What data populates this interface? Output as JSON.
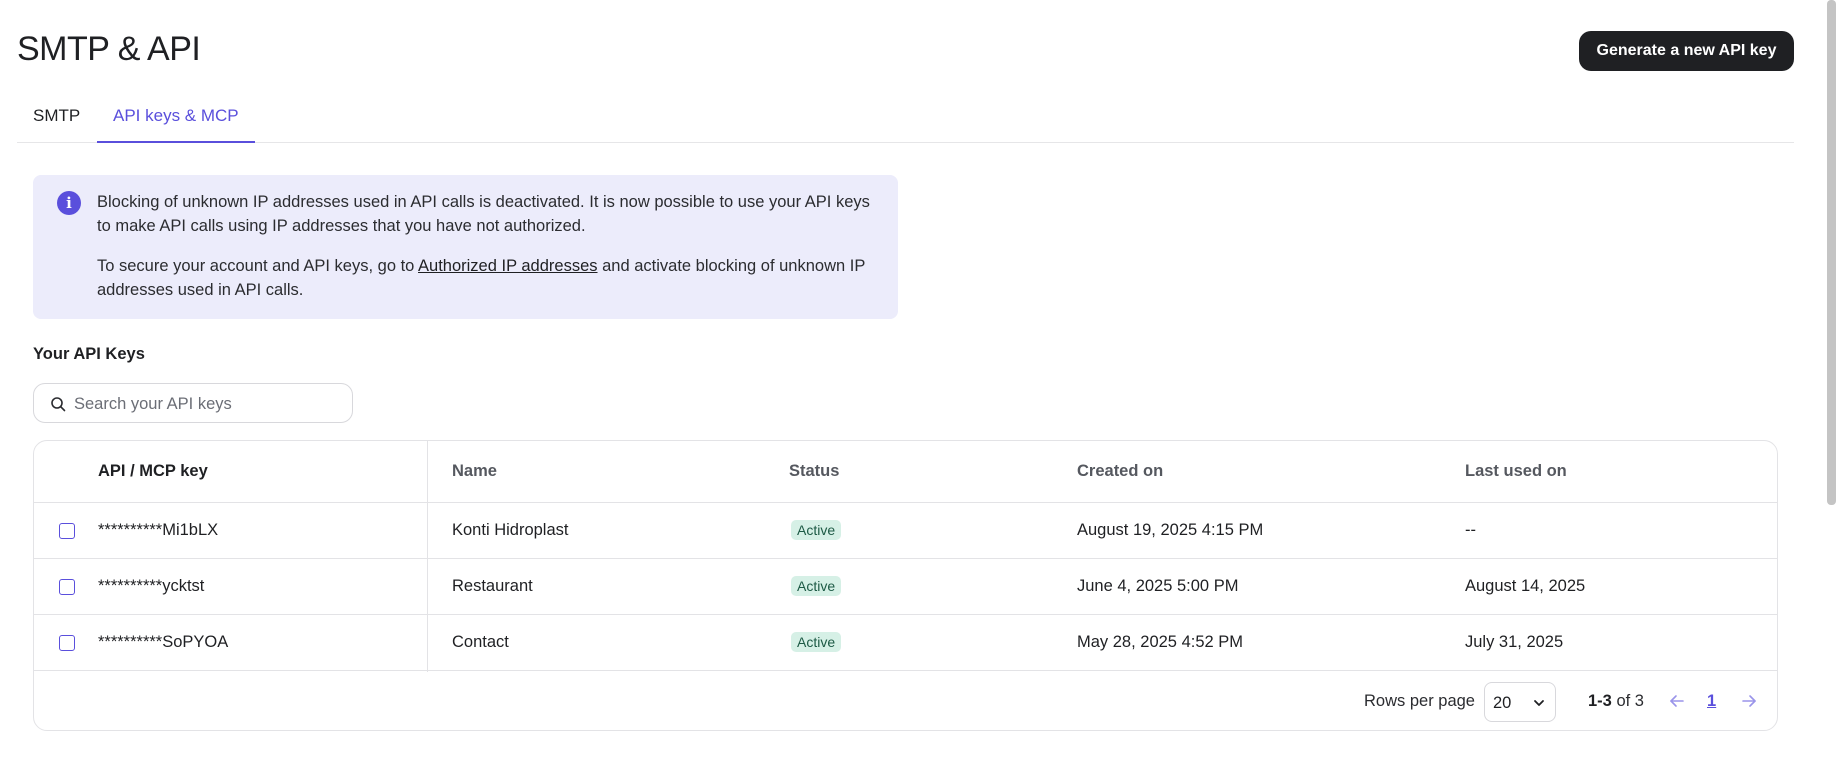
{
  "header": {
    "title": "SMTP & API",
    "generate_button": "Generate a new API key"
  },
  "tabs": [
    {
      "label": "SMTP",
      "active": false
    },
    {
      "label": "API keys & MCP",
      "active": true
    }
  ],
  "info": {
    "paragraph1": "Blocking of unknown IP addresses used in API calls is deactivated. It is now possible to use your API keys to make API calls using IP addresses that you have not authorized.",
    "paragraph2_before": "To secure your account and API keys, go to ",
    "paragraph2_link": "Authorized IP addresses",
    "paragraph2_after": " and activate blocking of unknown IP addresses used in API calls.",
    "icon": "info-icon"
  },
  "keys_section": {
    "title": "Your API Keys",
    "search_placeholder": "Search your API keys"
  },
  "table": {
    "columns": [
      "API / MCP key",
      "Name",
      "Status",
      "Created on",
      "Last used on"
    ],
    "rows": [
      {
        "key": "**********Mi1bLX",
        "name": "Konti Hidroplast",
        "status": "Active",
        "created": "August 19, 2025 4:15 PM",
        "last_used": "--"
      },
      {
        "key": "**********ycktst",
        "name": "Restaurant",
        "status": "Active",
        "created": "June 4, 2025 5:00 PM",
        "last_used": "August 14, 2025"
      },
      {
        "key": "**********SoPYOA",
        "name": "Contact",
        "status": "Active",
        "created": "May 28, 2025 4:52 PM",
        "last_used": "July 31, 2025"
      }
    ]
  },
  "pagination": {
    "rows_per_page_label": "Rows per page",
    "rows_per_page": "20",
    "range": "1-3",
    "of_text": "of 3",
    "current_page": "1"
  },
  "colors": {
    "accent": "#5a4fdc",
    "info_bg": "#ececfb",
    "badge_bg": "#d6f0e6",
    "button_bg": "#1f2023"
  }
}
